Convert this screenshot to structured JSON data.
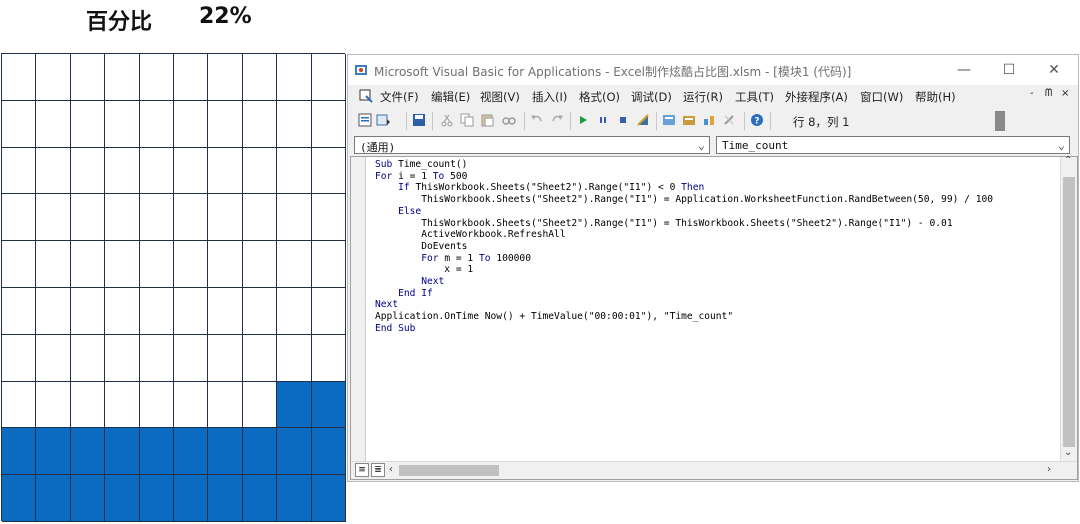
{
  "heading": {
    "label": "百分比",
    "value": "22%"
  },
  "grid": {
    "rows": 10,
    "cols": 10,
    "filled_cells": 22,
    "fill_color": "#0a6bc1",
    "line_color": "#22304a"
  },
  "window": {
    "title": "Microsoft Visual Basic for Applications - Excel制作炫酷占比图.xlsm - [模块1 (代码)]",
    "controls": {
      "minimize": "—",
      "maximize": "☐",
      "close": "✕"
    },
    "menu": [
      "文件(F)",
      "编辑(E)",
      "视图(V)",
      "插入(I)",
      "格式(O)",
      "调试(D)",
      "运行(R)",
      "工具(T)",
      "外接程序(A)",
      "窗口(W)",
      "帮助(H)"
    ],
    "mdi_controls": {
      "minimize": "-",
      "restore": "ᗰ",
      "close": "×"
    },
    "toolbar": {
      "position_text": "行 8，列 1",
      "icons": [
        "view-excel-icon",
        "insert-module-icon",
        "save-icon",
        "cut-icon",
        "copy-icon",
        "paste-icon",
        "find-icon",
        "undo-icon",
        "redo-icon",
        "run-icon",
        "break-icon",
        "reset-icon",
        "design-mode-icon",
        "project-explorer-icon",
        "properties-icon",
        "object-browser-icon",
        "toolbox-icon",
        "help-icon"
      ]
    },
    "object_combo": "(通用)",
    "procedure_combo": "Time_count",
    "code_lines": [
      "Sub Time_count()",
      "For i = 1 To 500",
      "    If ThisWorkbook.Sheets(\"Sheet2\").Range(\"I1\") < 0 Then",
      "        ThisWorkbook.Sheets(\"Sheet2\").Range(\"I1\") = Application.WorksheetFunction.RandBetween(50, 99) / 100",
      "    Else",
      "        ThisWorkbook.Sheets(\"Sheet2\").Range(\"I1\") = ThisWorkbook.Sheets(\"Sheet2\").Range(\"I1\") - 0.01",
      "        ActiveWorkbook.RefreshAll",
      "        DoEvents",
      "        For m = 1 To 100000",
      "            x = 1",
      "        Next",
      "    End If",
      "Next",
      "Application.OnTime Now() + TimeValue(\"00:00:01\"), \"Time_count\"",
      "End Sub"
    ]
  }
}
